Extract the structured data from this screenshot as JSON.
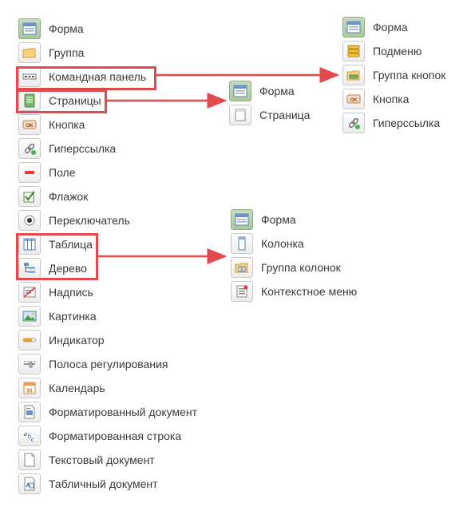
{
  "main_list": [
    {
      "label": "Форма",
      "icon": "form-icon"
    },
    {
      "label": "Группа",
      "icon": "folder-icon"
    },
    {
      "label": "Командная панель",
      "icon": "command-bar-icon"
    },
    {
      "label": "Страницы",
      "icon": "pages-icon"
    },
    {
      "label": "Кнопка",
      "icon": "button-icon"
    },
    {
      "label": "Гиперссылка",
      "icon": "hyperlink-icon"
    },
    {
      "label": "Поле",
      "icon": "field-icon"
    },
    {
      "label": "Флажок",
      "icon": "checkbox-icon"
    },
    {
      "label": "Переключатель",
      "icon": "radio-button-icon"
    },
    {
      "label": "Таблица",
      "icon": "table-icon"
    },
    {
      "label": "Дерево",
      "icon": "tree-icon"
    },
    {
      "label": "Надпись",
      "icon": "label-icon"
    },
    {
      "label": "Картинка",
      "icon": "picture-icon"
    },
    {
      "label": "Индикатор",
      "icon": "indicator-icon"
    },
    {
      "label": "Полоса регулирования",
      "icon": "slider-icon"
    },
    {
      "label": "Календарь",
      "icon": "calendar-icon"
    },
    {
      "label": "Форматированный документ",
      "icon": "formatted-document-icon"
    },
    {
      "label": "Форматированная строка",
      "icon": "formatted-string-icon"
    },
    {
      "label": "Текстовый документ",
      "icon": "text-document-icon"
    },
    {
      "label": "Табличный документ",
      "icon": "spreadsheet-document-icon"
    }
  ],
  "pages_list": [
    {
      "label": "Форма",
      "icon": "form-icon"
    },
    {
      "label": "Страница",
      "icon": "page-icon"
    }
  ],
  "command_bar_list": [
    {
      "label": "Форма",
      "icon": "form-icon"
    },
    {
      "label": "Подменю",
      "icon": "submenu-icon"
    },
    {
      "label": "Группа кнопок",
      "icon": "button-group-icon"
    },
    {
      "label": "Кнопка",
      "icon": "button-icon"
    },
    {
      "label": "Гиперссылка",
      "icon": "hyperlink-icon"
    }
  ],
  "table_list": [
    {
      "label": "Форма",
      "icon": "form-icon"
    },
    {
      "label": "Колонка",
      "icon": "column-icon"
    },
    {
      "label": "Группа колонок",
      "icon": "column-group-icon"
    },
    {
      "label": "Контекстное меню",
      "icon": "context-menu-icon"
    }
  ],
  "colors": {
    "highlight": "#e24a4f",
    "active_bg": "#b5cfa9",
    "text": "#3a3a3a"
  }
}
